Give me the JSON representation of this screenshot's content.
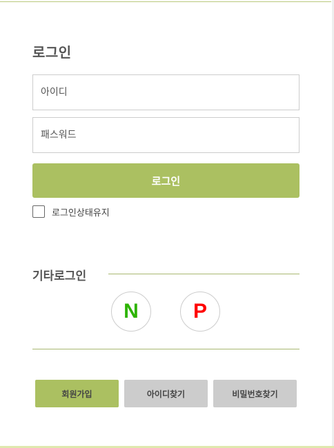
{
  "page": {
    "title": "로그인"
  },
  "form": {
    "id_placeholder": "아이디",
    "password_placeholder": "패스워드",
    "login_button": "로그인",
    "keep_logged_in_label": "로그인상태유지",
    "keep_logged_in_checked": false
  },
  "other_login": {
    "title": "기타로그인",
    "providers": [
      {
        "glyph": "N",
        "icon": "naver-icon",
        "color": "#2db400"
      },
      {
        "glyph": "P",
        "icon": "payco-icon",
        "color": "#ff0000"
      }
    ]
  },
  "actions": {
    "join": "회원가입",
    "find_id": "아이디찾기",
    "find_password": "비밀번호찾기"
  },
  "colors": {
    "accent": "#abc061",
    "secondary_button": "#cccccc",
    "rule": "#a8b870"
  }
}
